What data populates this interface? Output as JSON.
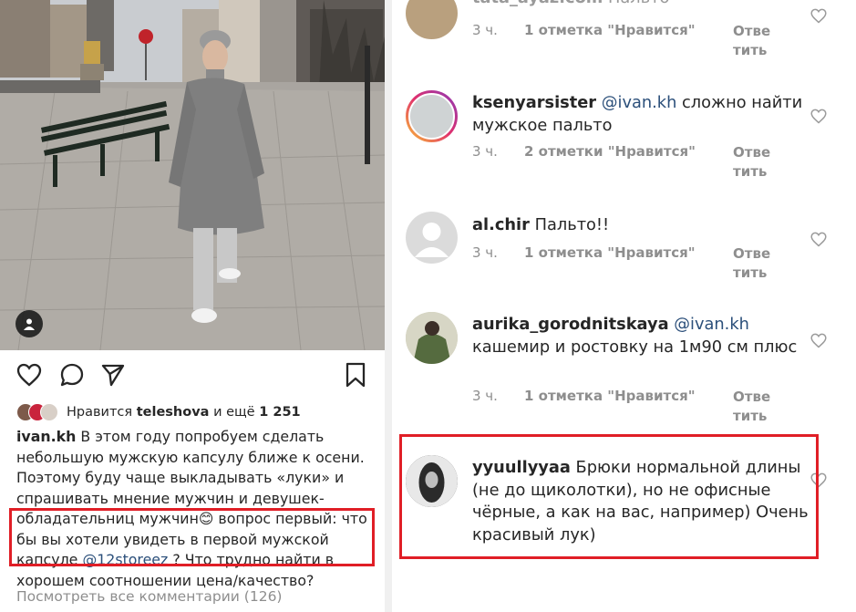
{
  "post": {
    "likes": {
      "prefix": "Нравится",
      "user": "teleshova",
      "middle": "и ещё",
      "count": "1 251"
    },
    "caption": {
      "user": "ivan.kh",
      "text_before": "В этом году попробуем сделать небольшую мужскую капсулу ближе к осени. Поэтому буду чаще выкладывать «луки» и спрашивать мнение мужчин и девушек-обладательниц мужчин😊 вопрос первый: что бы вы хотели увидеть в первой мужской капсуле",
      "mention": "@12storeez",
      "text_after": "? Что трудно найти в хорошем соотношении цена/качество?"
    },
    "view_all_comments": "Посмотреть все комментарии (126)",
    "icons": [
      "heart-icon",
      "comment-icon",
      "share-icon",
      "bookmark-icon",
      "user-tag-icon"
    ]
  },
  "comments": [
    {
      "user": "tata_ayaz.com",
      "mention": "",
      "text": "Пальто",
      "time": "3 ч.",
      "likes": "1 отметка \"Нравится\"",
      "reply": "Ответить"
    },
    {
      "user": "ksenyarsister",
      "mention": "@ivan.kh",
      "text": "сложно найти мужское пальто",
      "time": "3 ч.",
      "likes": "2 отметки \"Нравится\"",
      "reply": "Ответить"
    },
    {
      "user": "al.chir",
      "mention": "",
      "text": "Пальто!!",
      "time": "3 ч.",
      "likes": "1 отметка \"Нравится\"",
      "reply": "Ответить"
    },
    {
      "user": "aurika_gorodnitskaya",
      "mention": "@ivan.kh",
      "text": "кашемир и ростовку на 1м90 см плюс",
      "time": "3 ч.",
      "likes": "1 отметка \"Нравится\"",
      "reply": "Ответить"
    },
    {
      "user": "yyuullyyaa",
      "mention": "",
      "text": "Брюки нормальной длины (не до щиколотки), но не офисные чёрные, а как на вас, например) Очень красивый лук)",
      "time": "",
      "likes": "",
      "reply": ""
    }
  ],
  "colors": {
    "highlight": "#e01e26",
    "mention": "#2b4f7a",
    "muted": "#8e8e8e",
    "text": "#262626"
  }
}
